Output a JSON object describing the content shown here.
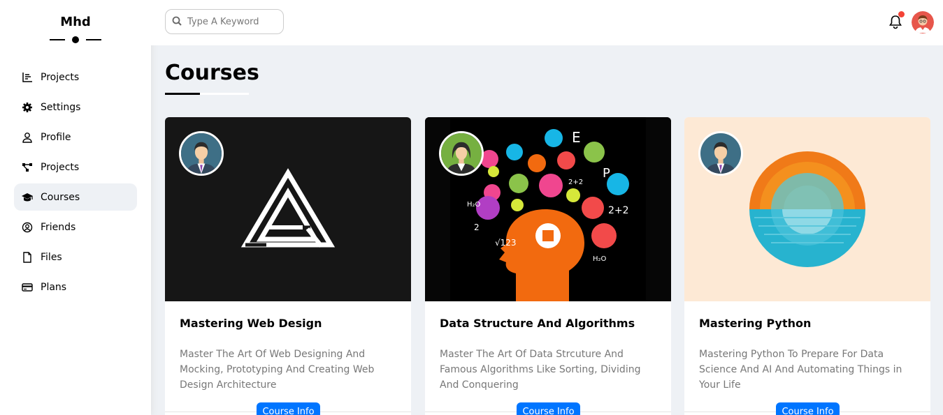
{
  "brand": "Mhd",
  "nav": [
    {
      "label": "Projects",
      "icon": "chart-icon"
    },
    {
      "label": "Settings",
      "icon": "gear-icon"
    },
    {
      "label": "Profile",
      "icon": "user-icon"
    },
    {
      "label": "Projects",
      "icon": "diagram-icon"
    },
    {
      "label": "Courses",
      "icon": "graduation-cap-icon",
      "active": true
    },
    {
      "label": "Friends",
      "icon": "user-circle-icon"
    },
    {
      "label": "Files",
      "icon": "file-icon"
    },
    {
      "label": "Plans",
      "icon": "credit-card-icon"
    }
  ],
  "search": {
    "placeholder": "Type A Keyword"
  },
  "notification_color": "#f44336",
  "page_title": "Courses",
  "courses": [
    {
      "title": "Mastering Web Design",
      "description": "Master The Art Of Web Designing And Mocking, Prototyping And Creating Web Design Architecture",
      "button": "Course Info",
      "image": "web-design-logo"
    },
    {
      "title": "Data Structure And Algorithms",
      "description": "Master The Art Of Data Strcuture And Famous Algorithms Like Sorting, Dividing And Conquering",
      "button": "Course Info",
      "image": "brain-head-icons"
    },
    {
      "title": "Mastering Python",
      "description": "Mastering Python To Prepare For Data Science And AI And Automating Things in Your Life",
      "button": "Course Info",
      "image": "sunset-circle"
    }
  ],
  "accent_color": "#0075ff"
}
